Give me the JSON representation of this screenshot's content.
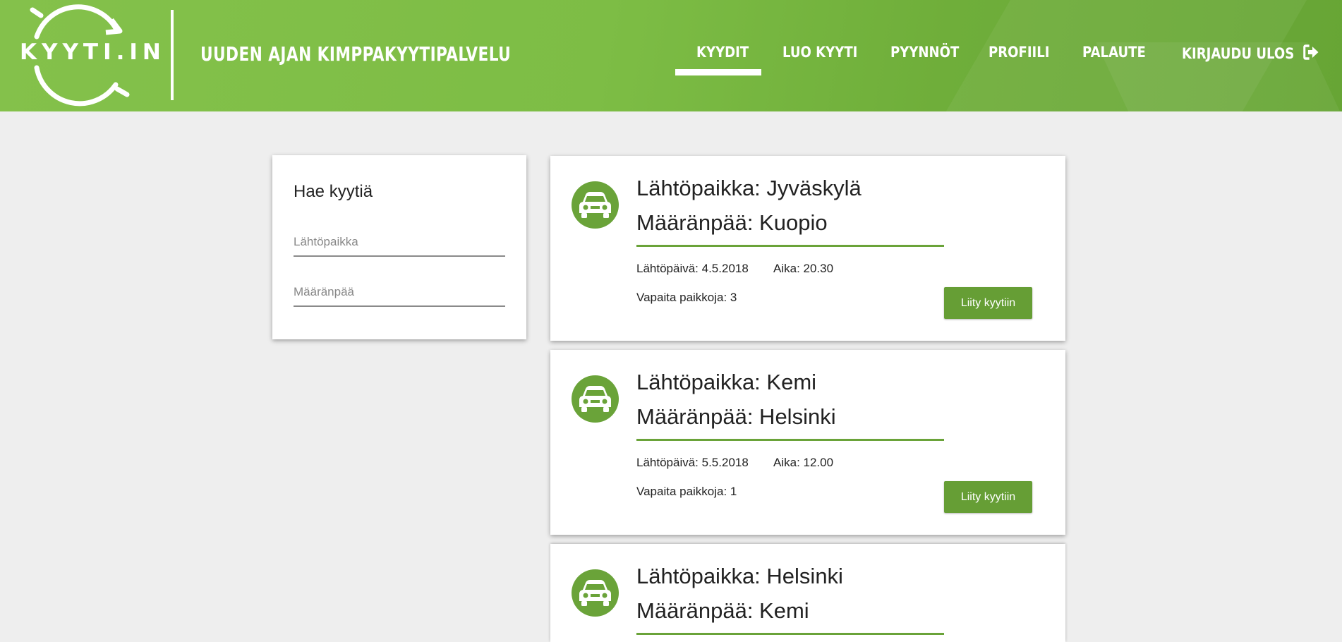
{
  "header": {
    "logo_text": "KYYTI.IN",
    "tagline": "UUDEN AJAN KIMPPAKYYTIPALVELU",
    "nav": [
      {
        "label": "KYYDIT",
        "active": true
      },
      {
        "label": "LUO KYYTI",
        "active": false
      },
      {
        "label": "PYYNNÖT",
        "active": false
      },
      {
        "label": "PROFIILI",
        "active": false
      },
      {
        "label": "PALAUTE",
        "active": false
      },
      {
        "label": "KIRJAUDU ULOS",
        "active": false,
        "icon": "logout-icon"
      }
    ]
  },
  "search": {
    "title": "Hae kyytiä",
    "from_placeholder": "Lähtöpaikka",
    "to_placeholder": "Määränpää"
  },
  "rides": [
    {
      "from": "Lähtöpaikka: Jyväskylä",
      "to": "Määränpää: Kuopio",
      "date": "Lähtöpäivä: 4.5.2018",
      "time": "Aika: 20.30",
      "seats": "Vapaita paikkoja: 3",
      "button": "Liity kyytiin",
      "icon": "car-icon"
    },
    {
      "from": "Lähtöpaikka: Kemi",
      "to": "Määränpää: Helsinki",
      "date": "Lähtöpäivä: 5.5.2018",
      "time": "Aika: 12.00",
      "seats": "Vapaita paikkoja: 1",
      "button": "Liity kyytiin",
      "icon": "car-icon"
    },
    {
      "from": "Lähtöpaikka: Helsinki",
      "to": "Määränpää: Kemi",
      "icon": "car-icon"
    }
  ],
  "colors": {
    "brand_green": "#7dbd45",
    "accent_green": "#6aa339",
    "background": "#eeeeee"
  }
}
